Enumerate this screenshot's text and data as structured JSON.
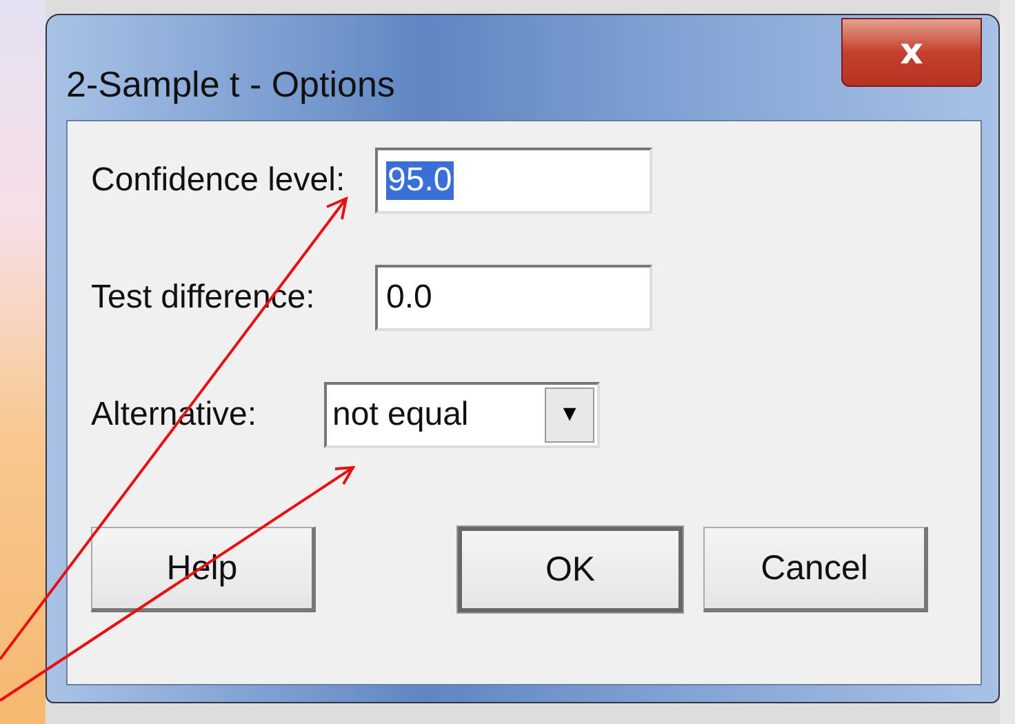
{
  "window": {
    "title": "2-Sample t - Options",
    "close": "x"
  },
  "fields": [
    {
      "kind": "text",
      "label": "Confidence level:",
      "value": "95.0",
      "selected": true
    },
    {
      "kind": "text",
      "label": "Test difference:",
      "value": "0.0",
      "selected": false
    },
    {
      "kind": "dropdown",
      "label": "Alternative:",
      "value": "not equal",
      "arrow": "▼"
    }
  ],
  "buttons": [
    {
      "label": "Help",
      "default": false
    },
    {
      "label": "OK",
      "default": true
    },
    {
      "label": "Cancel",
      "default": false
    }
  ]
}
